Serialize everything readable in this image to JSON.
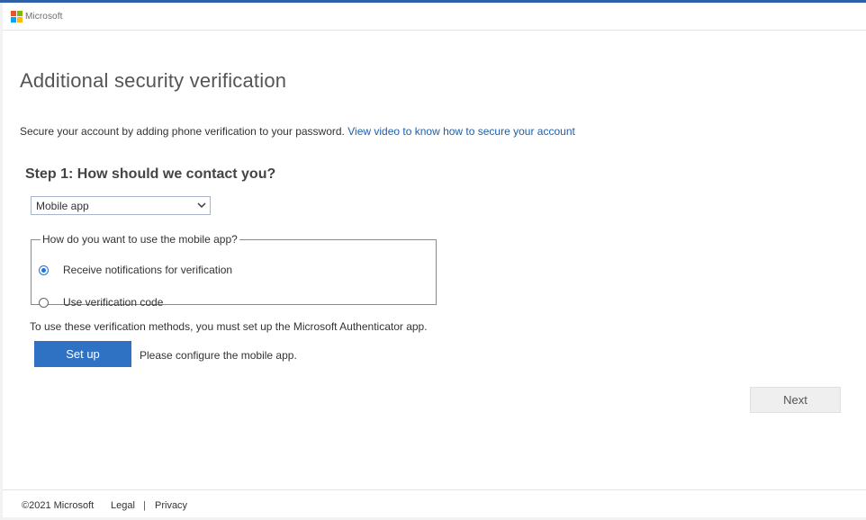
{
  "header": {
    "brand": "Microsoft",
    "logo_colors": [
      "#f25022",
      "#7fba00",
      "#00a4ef",
      "#ffb900"
    ]
  },
  "main": {
    "title": "Additional security verification",
    "intro_text": "Secure your account by adding phone verification to your password.",
    "intro_link": "View video to know how to secure your account",
    "step_heading": "Step 1: How should we contact you?",
    "contact_method": {
      "selected": "Mobile app"
    },
    "mobile_app_group": {
      "legend": "How do you want to use the mobile app?",
      "options": [
        {
          "label": "Receive notifications for verification",
          "checked": true
        },
        {
          "label": "Use verification code",
          "checked": false
        }
      ]
    },
    "note": "To use these verification methods, you must set up the Microsoft Authenticator app.",
    "setup_button": "Set up",
    "setup_message": "Please configure the mobile app.",
    "next_button": "Next"
  },
  "footer": {
    "copyright": "©2021 Microsoft",
    "legal": "Legal",
    "separator": "|",
    "privacy": "Privacy"
  },
  "colors": {
    "accent": "#2f72c4",
    "link": "#1f5ea8",
    "top_bar": "#2f5fa8"
  }
}
